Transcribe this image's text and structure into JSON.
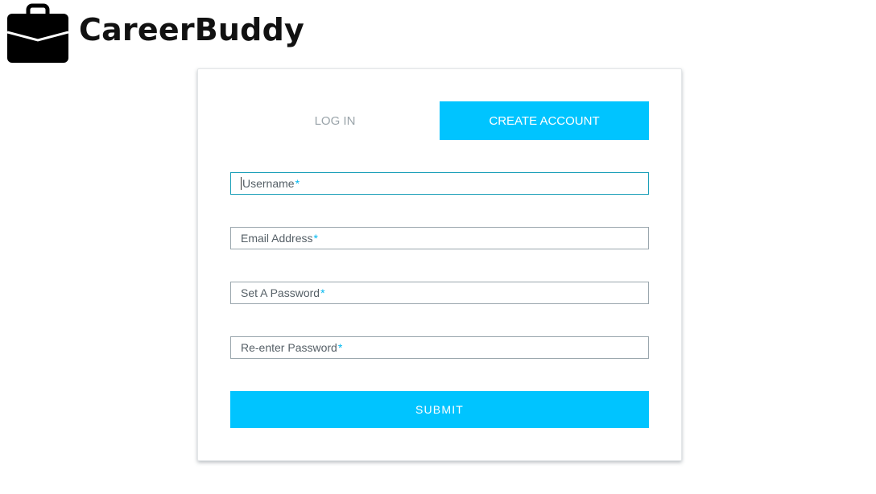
{
  "brand": {
    "name": "CareerBuddy",
    "icon": "briefcase-icon"
  },
  "tabs": {
    "login_label": "LOG IN",
    "create_label": "CREATE ACCOUNT",
    "active": "create"
  },
  "form": {
    "required_marker": "*",
    "fields": [
      {
        "placeholder": "Username",
        "value": "",
        "focused": true
      },
      {
        "placeholder": "Email Address",
        "value": ""
      },
      {
        "placeholder": "Set A Password",
        "value": ""
      },
      {
        "placeholder": "Re-enter Password",
        "value": ""
      }
    ],
    "submit_label": "SUBMIT"
  },
  "colors": {
    "accent": "#00c4ff",
    "inactive_tab_text": "#9aa4aa",
    "field_border": "#9aa6ad",
    "focus_border": "#1a9fb8"
  }
}
